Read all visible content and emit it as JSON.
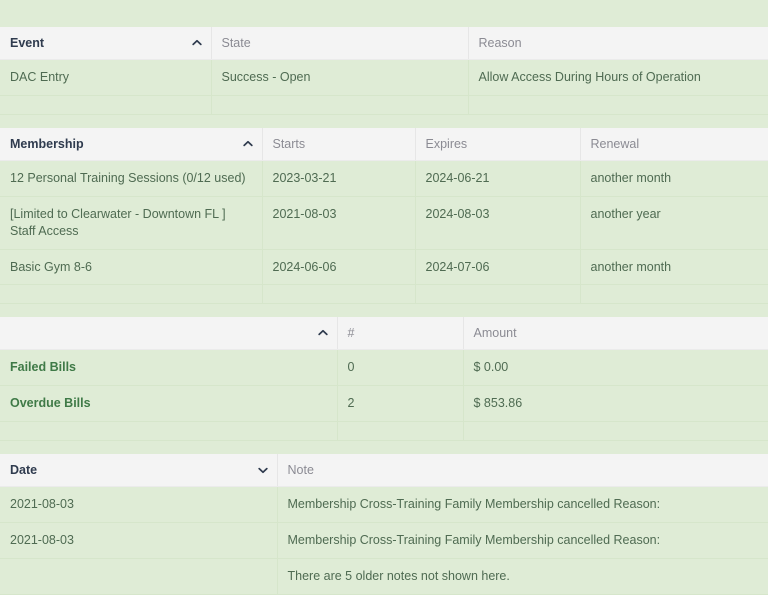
{
  "colors": {
    "page_background": "#dfecd6",
    "header_background": "#f4f4f4",
    "row_background": "#dfecd6",
    "body_text": "#4f6b52",
    "header_text": "#8b8b93",
    "sorted_header_text": "#2f3b4e",
    "bold_label_text": "#3f7a47"
  },
  "event_table": {
    "columns": [
      {
        "label": "Event",
        "sorted": true,
        "sort_icon": "chevron-up-icon"
      },
      {
        "label": "State",
        "sorted": false,
        "sort_icon": ""
      },
      {
        "label": "Reason",
        "sorted": false,
        "sort_icon": ""
      }
    ],
    "rows": [
      {
        "event": "DAC Entry",
        "state": "Success - Open",
        "reason": "Allow Access During Hours of Operation"
      }
    ]
  },
  "membership_table": {
    "columns": [
      {
        "label": "Membership",
        "sorted": true,
        "sort_icon": "chevron-up-icon"
      },
      {
        "label": "Starts",
        "sorted": false,
        "sort_icon": ""
      },
      {
        "label": "Expires",
        "sorted": false,
        "sort_icon": ""
      },
      {
        "label": "Renewal",
        "sorted": false,
        "sort_icon": ""
      }
    ],
    "rows": [
      {
        "membership": "12 Personal Training Sessions (0/12 used)",
        "starts": "2023-03-21",
        "expires": "2024-06-21",
        "renewal": "another month"
      },
      {
        "membership": "[Limited to Clearwater - Downtown FL ] Staff Access",
        "starts": "2021-08-03",
        "expires": "2024-08-03",
        "renewal": "another year"
      },
      {
        "membership": "Basic Gym 8-6",
        "starts": "2024-06-06",
        "expires": "2024-07-06",
        "renewal": "another month"
      }
    ]
  },
  "bills_table": {
    "columns": [
      {
        "label": "",
        "sorted": true,
        "sort_icon": "chevron-up-icon"
      },
      {
        "label": "#",
        "sorted": false,
        "sort_icon": ""
      },
      {
        "label": "Amount",
        "sorted": false,
        "sort_icon": ""
      }
    ],
    "rows": [
      {
        "name": "Failed Bills",
        "count": "0",
        "amount": "$ 0.00"
      },
      {
        "name": "Overdue Bills",
        "count": "2",
        "amount": "$ 853.86"
      }
    ]
  },
  "notes_table": {
    "columns": [
      {
        "label": "Date",
        "sorted": true,
        "sort_icon": "chevron-down-icon"
      },
      {
        "label": "Note",
        "sorted": false,
        "sort_icon": ""
      }
    ],
    "rows": [
      {
        "date": "2021-08-03",
        "note": "Membership Cross-Training Family Membership cancelled Reason:"
      },
      {
        "date": "2021-08-03",
        "note": "Membership Cross-Training Family Membership cancelled Reason:"
      },
      {
        "date": "",
        "note": "There are 5 older notes not shown here."
      }
    ]
  }
}
